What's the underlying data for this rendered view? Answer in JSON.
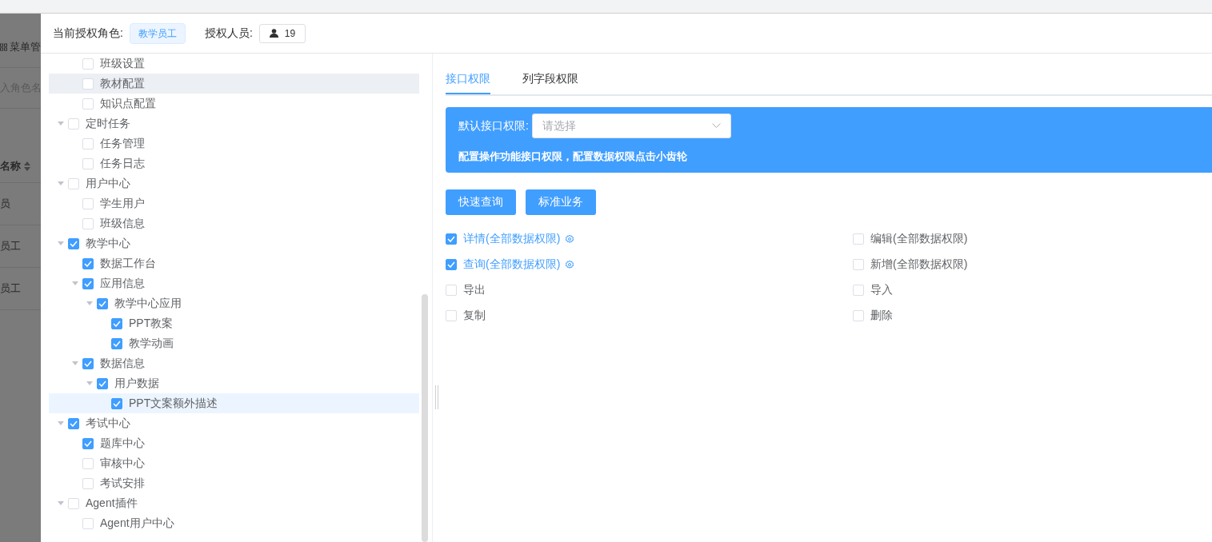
{
  "background_page": {
    "menu_label": "菜单管",
    "search_placeholder": "入角色名",
    "column_header": "名称",
    "rows": [
      "员",
      "员工",
      "员工"
    ]
  },
  "header": {
    "role_label": "当前授权角色:",
    "role_tag": "教学员工",
    "people_label": "授权人员:",
    "people_count": "19"
  },
  "tree": {
    "continued_children": [
      {
        "label": "班级设置",
        "checked": false,
        "selected": false,
        "hovered": false
      },
      {
        "label": "教材配置",
        "checked": false,
        "selected": false,
        "hovered": true
      },
      {
        "label": "知识点配置",
        "checked": false,
        "selected": false,
        "hovered": false
      }
    ],
    "items": [
      {
        "label": "定时任务",
        "checked": false,
        "expanded": true,
        "selected": false,
        "hovered": false,
        "children": [
          {
            "label": "任务管理",
            "checked": false,
            "selected": false,
            "hovered": false
          },
          {
            "label": "任务日志",
            "checked": false,
            "selected": false,
            "hovered": false
          }
        ]
      },
      {
        "label": "用户中心",
        "checked": false,
        "expanded": true,
        "selected": false,
        "hovered": false,
        "children": [
          {
            "label": "学生用户",
            "checked": false,
            "selected": false,
            "hovered": false
          },
          {
            "label": "班级信息",
            "checked": false,
            "selected": false,
            "hovered": false
          }
        ]
      },
      {
        "label": "教学中心",
        "checked": true,
        "expanded": true,
        "selected": false,
        "hovered": false,
        "children": [
          {
            "label": "数据工作台",
            "checked": true,
            "selected": false,
            "hovered": false
          },
          {
            "label": "应用信息",
            "checked": true,
            "expanded": true,
            "selected": false,
            "hovered": false,
            "children": [
              {
                "label": "教学中心应用",
                "checked": true,
                "expanded": true,
                "selected": false,
                "hovered": false,
                "children": [
                  {
                    "label": "PPT教案",
                    "checked": true,
                    "selected": false,
                    "hovered": false
                  },
                  {
                    "label": "教学动画",
                    "checked": true,
                    "selected": false,
                    "hovered": false
                  }
                ]
              }
            ]
          },
          {
            "label": "数据信息",
            "checked": true,
            "expanded": true,
            "selected": false,
            "hovered": false,
            "children": [
              {
                "label": "用户数据",
                "checked": true,
                "expanded": true,
                "selected": false,
                "hovered": false,
                "children": [
                  {
                    "label": "PPT文案额外描述",
                    "checked": true,
                    "selected": true,
                    "hovered": false
                  }
                ]
              }
            ]
          }
        ]
      },
      {
        "label": "考试中心",
        "checked": true,
        "expanded": true,
        "selected": false,
        "hovered": false,
        "children": [
          {
            "label": "题库中心",
            "checked": true,
            "selected": false,
            "hovered": false
          },
          {
            "label": "审核中心",
            "checked": false,
            "selected": false,
            "hovered": false
          },
          {
            "label": "考试安排",
            "checked": false,
            "selected": false,
            "hovered": false
          }
        ]
      },
      {
        "label": "Agent插件",
        "checked": false,
        "expanded": true,
        "selected": false,
        "hovered": false,
        "children": [
          {
            "label": "Agent用户中心",
            "checked": false,
            "selected": false,
            "hovered": false
          }
        ]
      }
    ]
  },
  "tabs": [
    {
      "label": "接口权限",
      "selected": true
    },
    {
      "label": "列字段权限",
      "selected": false
    }
  ],
  "banner": {
    "select_label": "默认接口权限:",
    "select_placeholder": "请选择",
    "note": "配置操作功能接口权限，配置数据权限点击小齿轮"
  },
  "buttons": [
    "快速查询",
    "标准业务"
  ],
  "permissions": [
    {
      "label": "详情(全部数据权限)",
      "checked": true
    },
    {
      "label": "编辑(全部数据权限)",
      "checked": false
    },
    {
      "label": "查询(全部数据权限)",
      "checked": true
    },
    {
      "label": "新增(全部数据权限)",
      "checked": false
    },
    {
      "label": "导出",
      "checked": false
    },
    {
      "label": "导入",
      "checked": false
    },
    {
      "label": "复制",
      "checked": false
    },
    {
      "label": "删除",
      "checked": false
    }
  ]
}
